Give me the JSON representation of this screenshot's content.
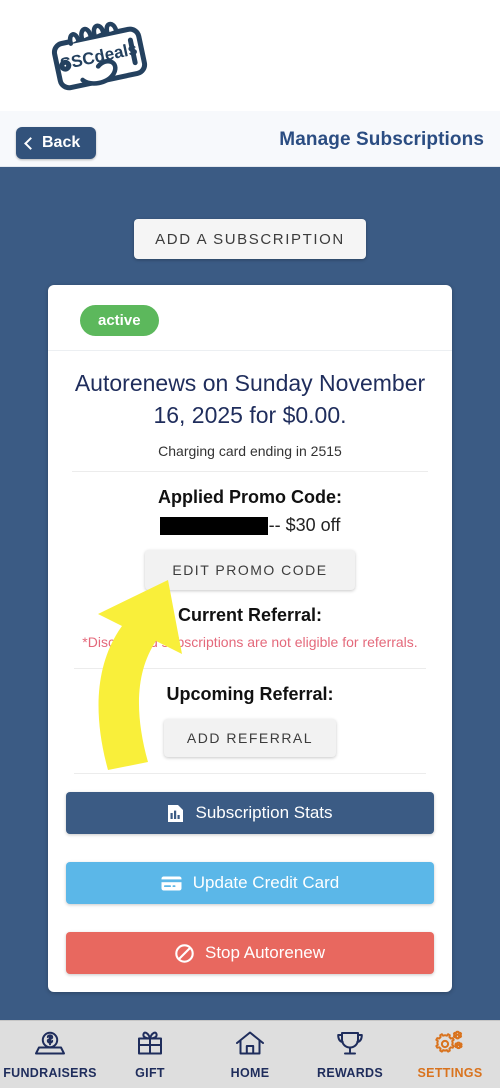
{
  "app": {
    "logo_alt": "SSCdeals",
    "logo_text": "SSCdeals"
  },
  "header": {
    "back_label": "Back",
    "title": "Manage Subscriptions"
  },
  "main": {
    "add_subscription_label": "ADD A SUBSCRIPTION"
  },
  "subscription": {
    "status_badge": "active",
    "title": "Autorenews on Sunday November 16, 2025 for $0.00.",
    "charging_text": "Charging card ending in 2515",
    "promo": {
      "heading": "Applied Promo Code:",
      "code_redacted": "",
      "discount_text": "-- $30 off",
      "edit_label": "EDIT PROMO CODE"
    },
    "current_referral": {
      "heading": "Current Referral:",
      "note": "*Discounted subscriptions are not eligible for referrals."
    },
    "upcoming_referral": {
      "heading": "Upcoming Referral:",
      "add_label": "ADD REFERRAL"
    },
    "actions": [
      {
        "label": "Subscription Stats",
        "icon": "chart-document-icon",
        "color": "#3b5b84"
      },
      {
        "label": "Update Credit Card",
        "icon": "credit-card-icon",
        "color": "#5bb7e8"
      },
      {
        "label": "Stop Autorenew",
        "icon": "no-entry-icon",
        "color": "#e8685f"
      }
    ]
  },
  "bottom_nav": [
    {
      "label": "FUNDRAISERS",
      "icon": "money-donation-icon",
      "active": false
    },
    {
      "label": "GIFT",
      "icon": "gift-icon",
      "active": false
    },
    {
      "label": "HOME",
      "icon": "home-icon",
      "active": false
    },
    {
      "label": "REWARDS",
      "icon": "trophy-icon",
      "active": false
    },
    {
      "label": "SETTINGS",
      "icon": "gears-icon",
      "active": true
    }
  ],
  "annotation": {
    "type": "curved-arrow",
    "color": "#f9ef3a",
    "points_to": "EDIT PROMO CODE"
  },
  "colors": {
    "page_background": "#3b5b84",
    "header_background": "#f7f9fc",
    "accent_navy": "#2b4d82",
    "status_green": "#5cb85c",
    "danger_red": "#e8685f",
    "info_blue": "#5bb7e8",
    "settings_orange": "#d9731e",
    "note_red": "#e4697b"
  }
}
